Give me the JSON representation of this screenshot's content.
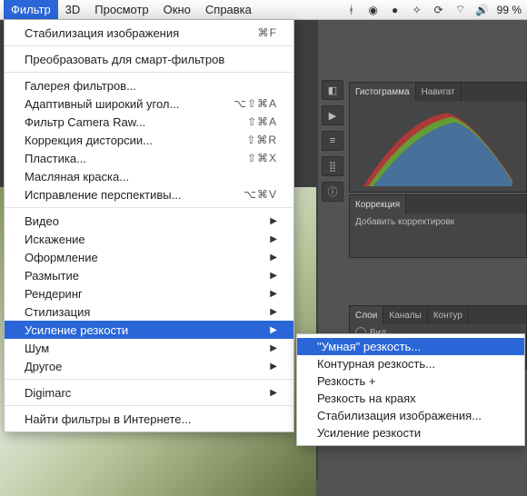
{
  "menubar": {
    "items": [
      "Фильтр",
      "3D",
      "Просмотр",
      "Окно",
      "Справка"
    ],
    "active_index": 0,
    "battery": "99 %",
    "icons": [
      "bt",
      "cc",
      "eye",
      "drop",
      "sync",
      "wifi",
      "vol"
    ]
  },
  "menu": {
    "groups": [
      [
        {
          "label": "Стабилизация изображения",
          "shortcut": "⌘F",
          "arrow": false
        }
      ],
      [
        {
          "label": "Преобразовать для смарт-фильтров",
          "shortcut": "",
          "arrow": false
        }
      ],
      [
        {
          "label": "Галерея фильтров...",
          "shortcut": "",
          "arrow": false
        },
        {
          "label": "Адаптивный широкий угол...",
          "shortcut": "⌥⇧⌘A",
          "arrow": false
        },
        {
          "label": "Фильтр Camera Raw...",
          "shortcut": "⇧⌘A",
          "arrow": false
        },
        {
          "label": "Коррекция дисторсии...",
          "shortcut": "⇧⌘R",
          "arrow": false
        },
        {
          "label": "Пластика...",
          "shortcut": "⇧⌘X",
          "arrow": false
        },
        {
          "label": "Масляная краска...",
          "shortcut": "",
          "arrow": false
        },
        {
          "label": "Исправление перспективы...",
          "shortcut": "⌥⌘V",
          "arrow": false
        }
      ],
      [
        {
          "label": "Видео",
          "shortcut": "",
          "arrow": true
        },
        {
          "label": "Искажение",
          "shortcut": "",
          "arrow": true
        },
        {
          "label": "Оформление",
          "shortcut": "",
          "arrow": true
        },
        {
          "label": "Размытие",
          "shortcut": "",
          "arrow": true
        },
        {
          "label": "Рендеринг",
          "shortcut": "",
          "arrow": true
        },
        {
          "label": "Стилизация",
          "shortcut": "",
          "arrow": true
        },
        {
          "label": "Усиление резкости",
          "shortcut": "",
          "arrow": true,
          "hi": true
        },
        {
          "label": "Шум",
          "shortcut": "",
          "arrow": true
        },
        {
          "label": "Другое",
          "shortcut": "",
          "arrow": true
        }
      ],
      [
        {
          "label": "Digimarc",
          "shortcut": "",
          "arrow": true
        }
      ],
      [
        {
          "label": "Найти фильтры в Интернете...",
          "shortcut": "",
          "arrow": false
        }
      ]
    ]
  },
  "submenu": {
    "items": [
      {
        "label": "\"Умная\" резкость...",
        "hi": true
      },
      {
        "label": "Контурная резкость...",
        "hi": false
      },
      {
        "label": "Резкость +",
        "hi": false
      },
      {
        "label": "Резкость на краях",
        "hi": false
      },
      {
        "label": "Стабилизация изображения...",
        "hi": false
      },
      {
        "label": "Усиление резкости",
        "hi": false
      }
    ]
  },
  "panels": {
    "histogram": {
      "tabs": [
        "Гистограмма",
        "Навигат"
      ],
      "active": 0
    },
    "correction": {
      "tabs": [
        "Коррекция"
      ],
      "active": 0,
      "add_label": "Добавить корректировк"
    },
    "layers": {
      "tabs": [
        "Слои",
        "Каналы",
        "Контур"
      ],
      "active": 0,
      "search": "Вид"
    }
  }
}
